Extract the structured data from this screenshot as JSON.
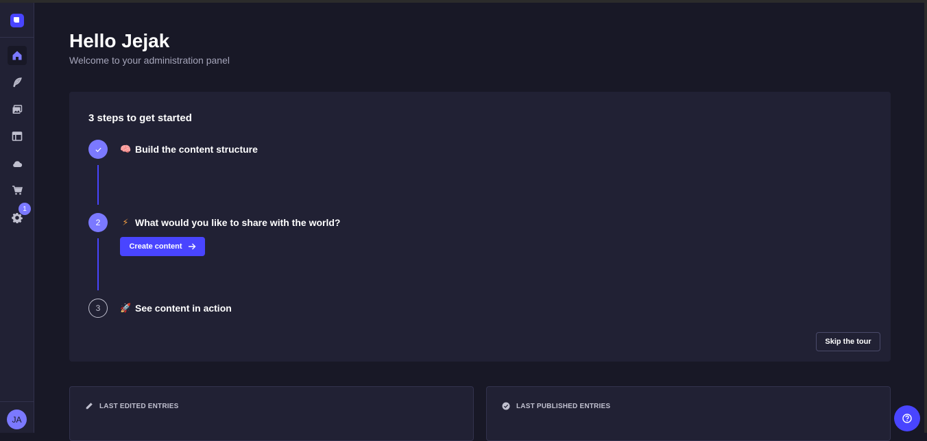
{
  "header": {
    "title": "Hello Jejak",
    "subtitle": "Welcome to your administration panel"
  },
  "sidebar": {
    "items": [
      {
        "icon": "home-icon",
        "active": true
      },
      {
        "icon": "feather-icon",
        "active": false
      },
      {
        "icon": "media-library-icon",
        "active": false
      },
      {
        "icon": "layout-icon",
        "active": false
      },
      {
        "icon": "cloud-icon",
        "active": false
      },
      {
        "icon": "cart-icon",
        "active": false
      },
      {
        "icon": "gear-icon",
        "active": false
      }
    ],
    "settings_badge": "1",
    "avatar_initials": "JA"
  },
  "steps": {
    "title": "3 steps to get started",
    "items": [
      {
        "number": "1",
        "state": "done",
        "emoji": "🧠",
        "label": "Build the content structure"
      },
      {
        "number": "2",
        "state": "current",
        "emoji": "⚡",
        "label": "What would you like to share with the world?"
      },
      {
        "number": "3",
        "state": "todo",
        "emoji": "🚀",
        "label": "See content in action"
      }
    ],
    "create_button": "Create content",
    "skip_button": "Skip the tour"
  },
  "panels": {
    "last_edited": "LAST EDITED ENTRIES",
    "last_published": "LAST PUBLISHED ENTRIES"
  },
  "colors": {
    "background": "#181826",
    "surface": "#212134",
    "primary": "#4945ff",
    "primary_light": "#7b79ff"
  }
}
